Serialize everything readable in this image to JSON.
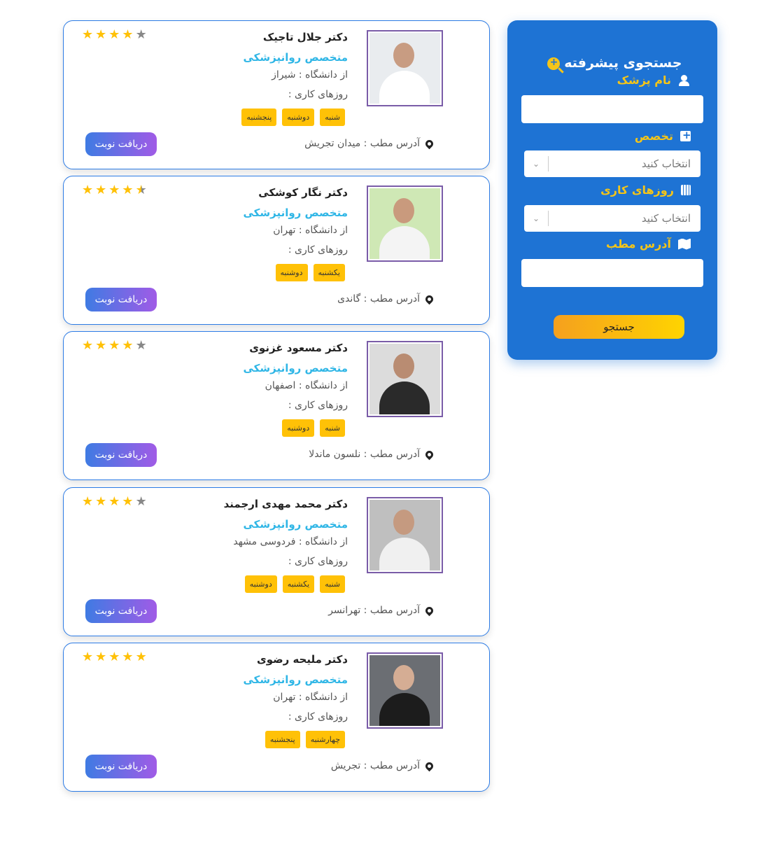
{
  "search": {
    "title": "جستجوی پیشرفته",
    "name_label": "نام پزشک",
    "name_value": "",
    "specialty_label": "تخصص",
    "specialty_value": "انتخاب کنید",
    "days_label": "روزهای کاری",
    "days_value": "انتخاب کنید",
    "address_label": "آدرس مطب",
    "address_value": "",
    "button": "جستجو"
  },
  "doctors": [
    {
      "name": "دکتر جلال تاجیک",
      "specialty": "متخصص روانپزشکی",
      "university": "از دانشگاه : شیراز",
      "days_label": "روزهای کاری :",
      "days": [
        "شنبه",
        "دوشنبه",
        "پنجشنبه"
      ],
      "address": "آدرس مطب : میدان تجریش",
      "button": "دریافت نوبت",
      "rating": 4
    },
    {
      "name": "دکتر نگار کوشکی",
      "specialty": "متخصص روانپزشکی",
      "university": "از دانشگاه : تهران",
      "days_label": "روزهای کاری :",
      "days": [
        "یکشنبه",
        "دوشنبه"
      ],
      "address": "آدرس مطب : گاندی",
      "button": "دریافت نوبت",
      "rating": 4.5
    },
    {
      "name": "دکتر مسعود غزنوی",
      "specialty": "متخصص روانپزشکی",
      "university": "از دانشگاه : اصفهان",
      "days_label": "روزهای کاری :",
      "days": [
        "شنبه",
        "دوشنبه"
      ],
      "address": "آدرس مطب : نلسون ماندلا",
      "button": "دریافت نوبت",
      "rating": 4
    },
    {
      "name": "دکتر محمد مهدی ارجمند",
      "specialty": "متخصص روانپزشکی",
      "university": "از دانشگاه : فردوسی مشهد",
      "days_label": "روزهای کاری :",
      "days": [
        "شنبه",
        "یکشنبه",
        "دوشنبه"
      ],
      "address": "آدرس مطب : تهرانسر",
      "button": "دریافت نوبت",
      "rating": 4
    },
    {
      "name": "دکتر ملیحه رضوی",
      "specialty": "متخصص روانپزشکی",
      "university": "از دانشگاه : تهران",
      "days_label": "روزهای کاری :",
      "days": [
        "چهارشنبه",
        "پنجشنبه"
      ],
      "address": "آدرس مطب : تجریش",
      "button": "دریافت نوبت",
      "rating": 5
    }
  ],
  "colors": {
    "panel": "#1e73d4",
    "accent": "#f5c518",
    "chip": "#ffc107",
    "specialty": "#2fb6e6"
  }
}
